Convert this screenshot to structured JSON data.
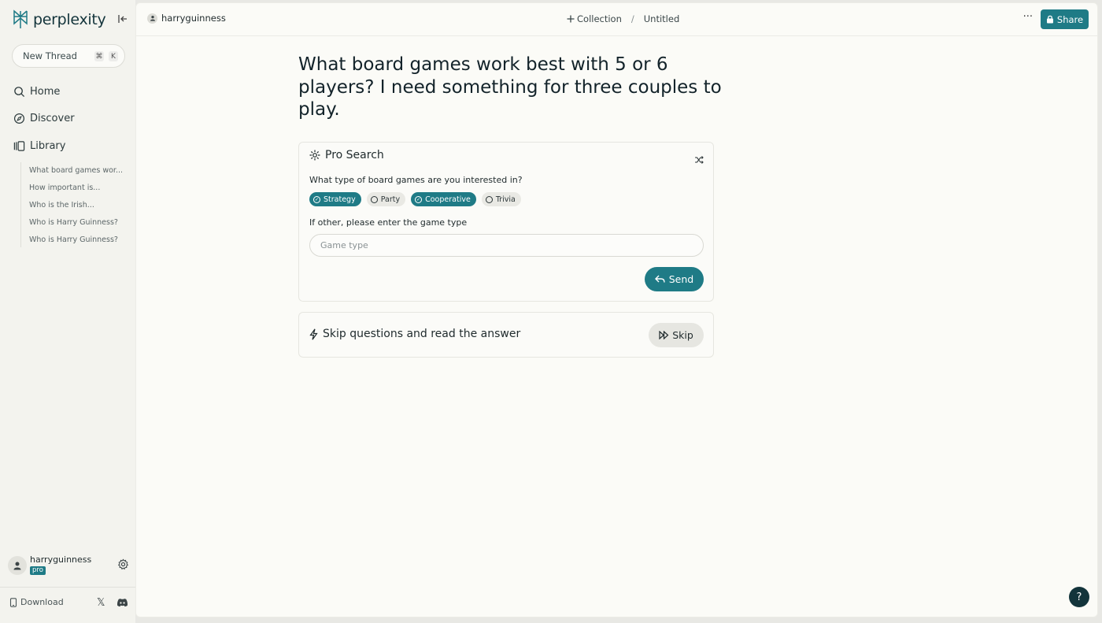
{
  "brand": {
    "name": "perplexity",
    "accent": "#1f7b86",
    "dark": "#13343b"
  },
  "sidebar": {
    "new_thread": {
      "label": "New Thread",
      "shortcut_cmd": "⌘",
      "shortcut_key": "K"
    },
    "nav": [
      {
        "label": "Home",
        "icon": "search-icon"
      },
      {
        "label": "Discover",
        "icon": "compass-icon"
      },
      {
        "label": "Library",
        "icon": "library-icon"
      }
    ],
    "library_items": [
      "What board games wor...",
      "How important is...",
      "Who is the Irish...",
      "Who is Harry Guinness?",
      "Who is Harry Guinness?"
    ],
    "user": {
      "name": "harryguinness",
      "badge": "pro"
    },
    "download_label": "Download"
  },
  "topbar": {
    "user": "harryguinness",
    "collection_label": "Collection",
    "separator": "/",
    "page_title": "Untitled",
    "more_label": "···",
    "share_label": "Share"
  },
  "main": {
    "question": "What board games work best with 5 or 6 players? I need something for three couples to play.",
    "pro_search": {
      "title": "Pro Search",
      "prompt": "What type of board games are you interested in?",
      "options": [
        {
          "label": "Strategy",
          "selected": true
        },
        {
          "label": "Party",
          "selected": false
        },
        {
          "label": "Cooperative",
          "selected": true
        },
        {
          "label": "Trivia",
          "selected": false
        }
      ],
      "other_label": "If other, please enter the game type",
      "input_placeholder": "Game type",
      "input_value": "",
      "send_label": "Send"
    },
    "skip": {
      "label": "Skip questions and read the answer",
      "button_label": "Skip"
    }
  },
  "help_label": "?"
}
